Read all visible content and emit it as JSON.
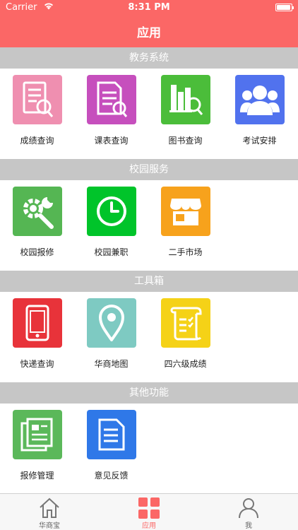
{
  "status_bar": {
    "carrier": "Carrier",
    "time": "8:31 PM",
    "battery_level": 0.95
  },
  "header": {
    "title": "应用"
  },
  "colors": {
    "accent": "#fb6766",
    "section_bg": "#c6c6c6"
  },
  "sections": [
    {
      "title": "教务系统",
      "items": [
        {
          "label": "成绩查询",
          "icon": "grade-query-icon",
          "color": "#ef8fb0"
        },
        {
          "label": "课表查询",
          "icon": "schedule-query-icon",
          "color": "#c64fbd"
        },
        {
          "label": "图书查询",
          "icon": "library-query-icon",
          "color": "#4bbd3a"
        },
        {
          "label": "考试安排",
          "icon": "exam-schedule-icon",
          "color": "#5172ee"
        }
      ]
    },
    {
      "title": "校园服务",
      "items": [
        {
          "label": "校园报修",
          "icon": "repair-icon",
          "color": "#55b653"
        },
        {
          "label": "校园兼职",
          "icon": "part-time-clock-icon",
          "color": "#00c42a"
        },
        {
          "label": "二手市场",
          "icon": "market-store-icon",
          "color": "#f7a21c"
        }
      ]
    },
    {
      "title": "工具箱",
      "items": [
        {
          "label": "快递查询",
          "icon": "phone-icon",
          "color": "#e8333a"
        },
        {
          "label": "华商地图",
          "icon": "map-pin-icon",
          "color": "#7ecac2"
        },
        {
          "label": "四六级成绩",
          "icon": "scroll-icon",
          "color": "#f5d217"
        }
      ]
    },
    {
      "title": "其他功能",
      "items": [
        {
          "label": "报修管理",
          "icon": "documents-icon",
          "color": "#5bb85a"
        },
        {
          "label": "意见反馈",
          "icon": "feedback-icon",
          "color": "#2f78e8"
        }
      ]
    }
  ],
  "tabbar": {
    "tabs": [
      {
        "label": "华商宝",
        "icon": "home-icon",
        "active": false
      },
      {
        "label": "应用",
        "icon": "apps-grid-icon",
        "active": true
      },
      {
        "label": "我",
        "icon": "profile-icon",
        "active": false
      }
    ]
  }
}
